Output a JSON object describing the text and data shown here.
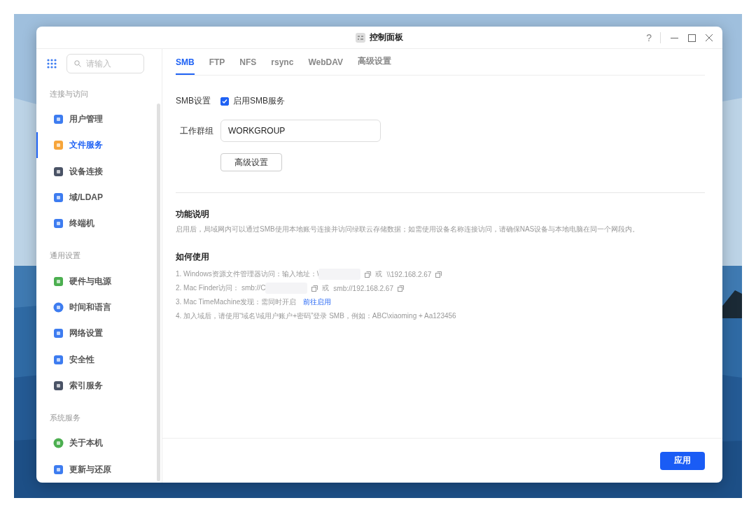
{
  "window": {
    "title": "控制面板",
    "help": "?"
  },
  "search": {
    "placeholder": "请输入"
  },
  "sidebar": {
    "sections": [
      {
        "title": "连接与访问",
        "items": [
          {
            "label": "用户管理",
            "selected": false
          },
          {
            "label": "文件服务",
            "selected": true
          },
          {
            "label": "设备连接",
            "selected": false
          },
          {
            "label": "域/LDAP",
            "selected": false
          },
          {
            "label": "终端机",
            "selected": false
          }
        ]
      },
      {
        "title": "通用设置",
        "items": [
          {
            "label": "硬件与电源",
            "selected": false
          },
          {
            "label": "时间和语言",
            "selected": false
          },
          {
            "label": "网络设置",
            "selected": false
          },
          {
            "label": "安全性",
            "selected": false
          },
          {
            "label": "索引服务",
            "selected": false
          }
        ]
      },
      {
        "title": "系统服务",
        "items": [
          {
            "label": "关于本机",
            "selected": false
          },
          {
            "label": "更新与还原",
            "selected": false
          }
        ]
      }
    ]
  },
  "tabs": [
    {
      "label": "SMB",
      "selected": true
    },
    {
      "label": "FTP",
      "selected": false
    },
    {
      "label": "NFS",
      "selected": false
    },
    {
      "label": "rsync",
      "selected": false
    },
    {
      "label": "WebDAV",
      "selected": false
    },
    {
      "label": "高级设置",
      "selected": false
    }
  ],
  "smb": {
    "label": "SMB设置",
    "checkbox": {
      "label": "启用SMB服务",
      "checked": true
    },
    "workgroup_label": "工作群组",
    "workgroup_value": "WORKGROUP",
    "advanced_button": "高级设置"
  },
  "description": {
    "title": "功能说明",
    "text": "启用后，局域网内可以通过SMB使用本地账号连接并访问绿联云存储数据；如需使用设备名称连接访问，请确保NAS设备与本地电脑在同一个网段内。"
  },
  "usage": {
    "title": "如何使用",
    "lines": [
      {
        "parts": [
          {
            "kind": "text",
            "text": "1. Windows资源文件管理器访问：输入地址：\\"
          },
          {
            "kind": "redacted"
          },
          {
            "kind": "copy"
          },
          {
            "kind": "text",
            "text": "或"
          },
          {
            "kind": "text",
            "text": "\\\\192.168.2.67"
          },
          {
            "kind": "copy"
          }
        ]
      },
      {
        "parts": [
          {
            "kind": "text",
            "text": "2. Mac Finder访问： smb://C"
          },
          {
            "kind": "redacted"
          },
          {
            "kind": "copy"
          },
          {
            "kind": "text",
            "text": "或"
          },
          {
            "kind": "text",
            "text": "smb://192.168.2.67"
          },
          {
            "kind": "copy"
          }
        ]
      },
      {
        "parts": [
          {
            "kind": "text",
            "text": "3. Mac TimeMachine发现：需同时开启"
          },
          {
            "kind": "link",
            "text": "前往启用"
          }
        ]
      },
      {
        "parts": [
          {
            "kind": "text",
            "text": "4. 加入域后，请使用“域名\\域用户账户+密码”登录 SMB，例如：ABC\\xiaoming + Aa123456"
          }
        ]
      }
    ]
  },
  "apply_button": "应用"
}
